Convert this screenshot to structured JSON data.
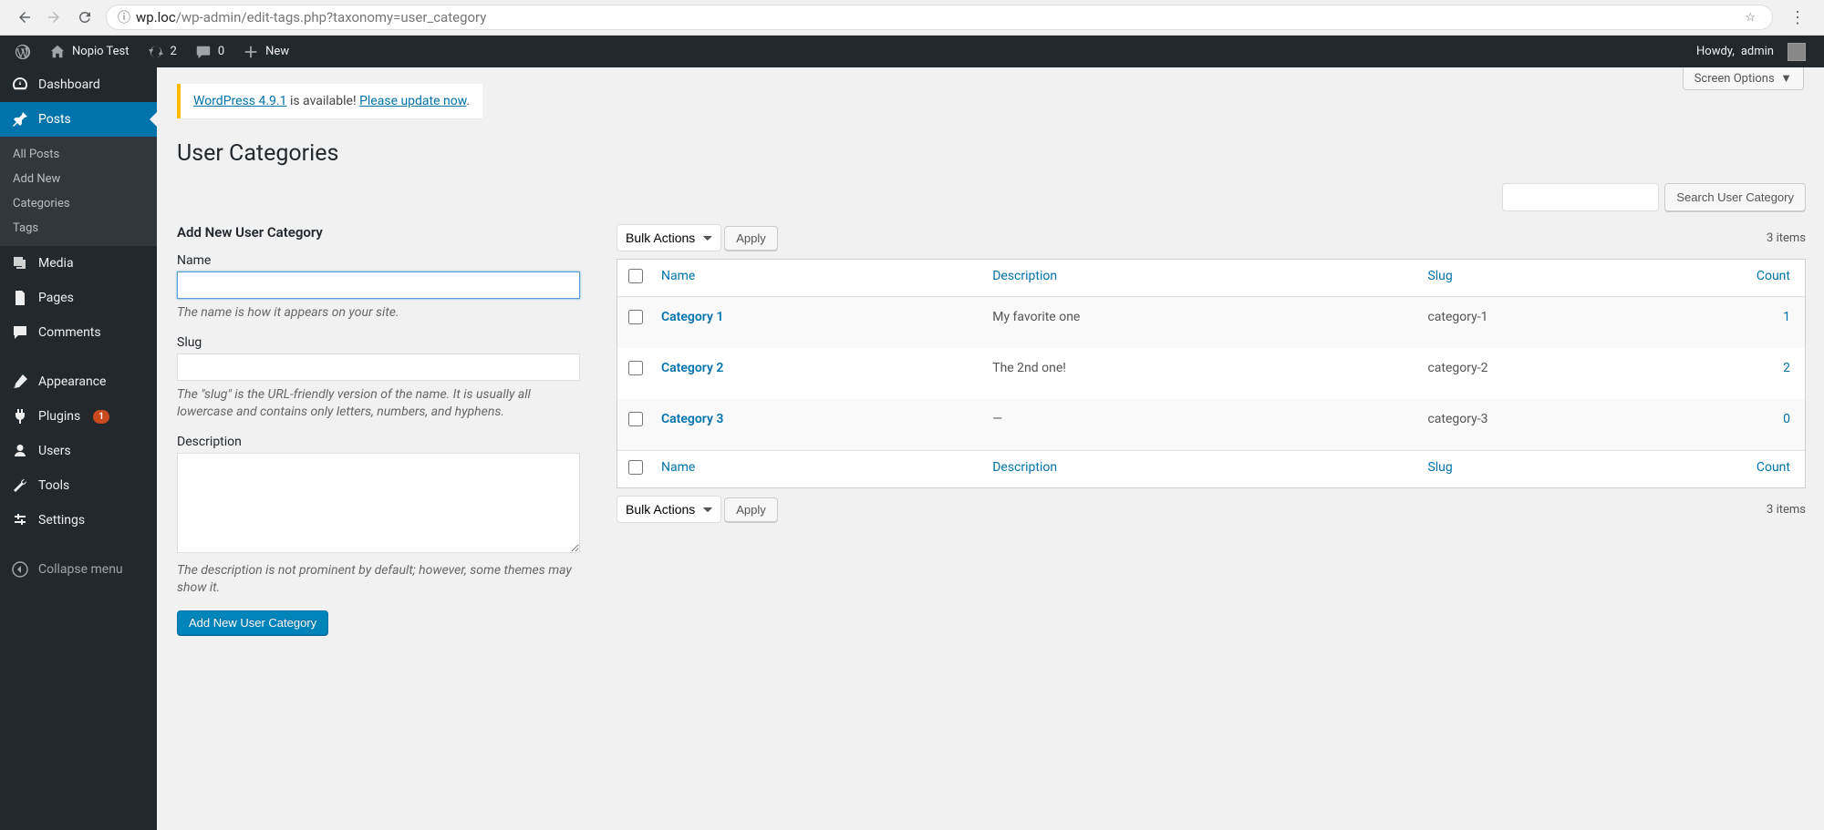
{
  "browser": {
    "url_host": "wp.loc",
    "url_path": "/wp-admin/edit-tags.php?taxonomy=user_category"
  },
  "admin_bar": {
    "site_name": "Nopio Test",
    "updates_count": "2",
    "comments_count": "0",
    "new_label": "New",
    "howdy_prefix": "Howdy, ",
    "user": "admin"
  },
  "menu": {
    "dashboard": "Dashboard",
    "posts": "Posts",
    "posts_sub": {
      "all": "All Posts",
      "add": "Add New",
      "categories": "Categories",
      "tags": "Tags"
    },
    "media": "Media",
    "pages": "Pages",
    "comments": "Comments",
    "appearance": "Appearance",
    "plugins": "Plugins",
    "plugins_badge": "1",
    "users": "Users",
    "tools": "Tools",
    "settings": "Settings",
    "collapse": "Collapse menu"
  },
  "screen_options_label": "Screen Options",
  "update_nag": {
    "wplink": "WordPress 4.9.1",
    "available": " is available! ",
    "pleaselink": "Please update now",
    "period": "."
  },
  "page_title": "User Categories",
  "search_button": "Search User Category",
  "form": {
    "title": "Add New User Category",
    "name_label": "Name",
    "name_desc": "The name is how it appears on your site.",
    "slug_label": "Slug",
    "slug_desc": "The \"slug\" is the URL-friendly version of the name. It is usually all lowercase and contains only letters, numbers, and hyphens.",
    "desc_label": "Description",
    "desc_desc": "The description is not prominent by default; however, some themes may show it.",
    "submit": "Add New User Category"
  },
  "bulk_actions_label": "Bulk Actions",
  "apply_label": "Apply",
  "items_count": "3 items",
  "table": {
    "col_name": "Name",
    "col_desc": "Description",
    "col_slug": "Slug",
    "col_count": "Count",
    "rows": [
      {
        "name": "Category 1",
        "desc": "My favorite one",
        "slug": "category-1",
        "count": "1"
      },
      {
        "name": "Category 2",
        "desc": "The 2nd one!",
        "slug": "category-2",
        "count": "2"
      },
      {
        "name": "Category 3",
        "desc": "—",
        "slug": "category-3",
        "count": "0"
      }
    ]
  }
}
